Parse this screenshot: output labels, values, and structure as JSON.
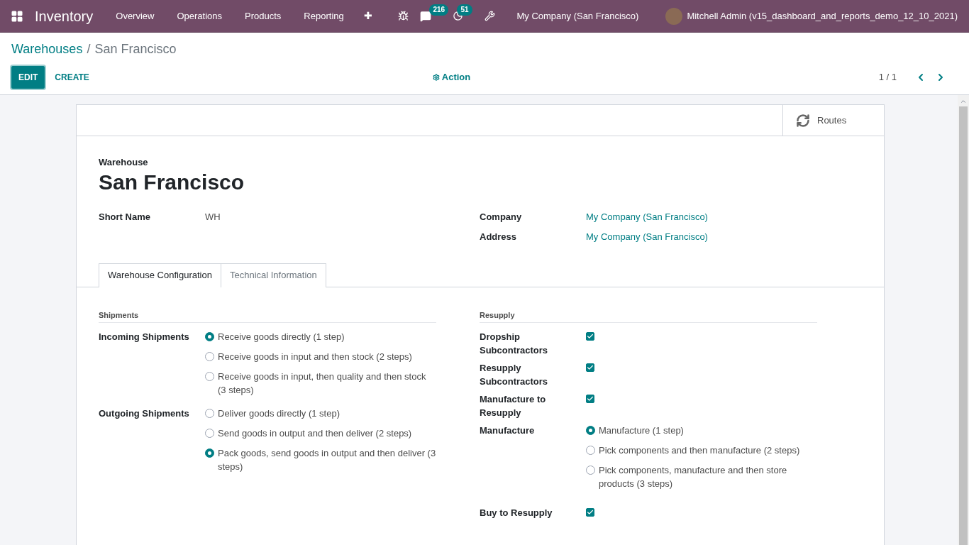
{
  "navbar": {
    "app_name": "Inventory",
    "menu": [
      "Overview",
      "Operations",
      "Products",
      "Reporting"
    ],
    "plus": "✚",
    "messages_count": "216",
    "activities_count": "51",
    "company": "My Company (San Francisco)",
    "user": "Mitchell Admin (v15_dashboard_and_reports_demo_12_10_2021)"
  },
  "breadcrumb": {
    "parent": "Warehouses",
    "separator": "/",
    "current": "San Francisco"
  },
  "control_panel": {
    "edit": "EDIT",
    "create": "CREATE",
    "action": "Action",
    "pager": "1 / 1"
  },
  "button_box": {
    "routes": "Routes"
  },
  "form": {
    "title_label": "Warehouse",
    "name": "San Francisco",
    "left_fields": [
      {
        "label": "Short Name",
        "value": "WH",
        "link": false
      }
    ],
    "right_fields": [
      {
        "label": "Company",
        "value": "My Company (San Francisco)",
        "link": true
      },
      {
        "label": "Address",
        "value": "My Company (San Francisco)",
        "link": true
      }
    ],
    "tabs": [
      {
        "label": "Warehouse Configuration",
        "selected": true
      },
      {
        "label": "Technical Information",
        "selected": false
      }
    ],
    "sections": [
      {
        "title": "Shipments",
        "rows": [
          {
            "label": "Incoming Shipments",
            "kind": "radio",
            "options": [
              {
                "label": "Receive goods directly (1 step)",
                "selected": true
              },
              {
                "label": "Receive goods in input and then stock (2 steps)",
                "selected": false
              },
              {
                "label": "Receive goods in input, then quality and then stock (3 steps)",
                "selected": false
              }
            ]
          },
          {
            "label": "Outgoing Shipments",
            "kind": "radio",
            "options": [
              {
                "label": "Deliver goods directly (1 step)",
                "selected": false
              },
              {
                "label": "Send goods in output and then deliver (2 steps)",
                "selected": false
              },
              {
                "label": "Pack goods, send goods in output and then deliver (3 steps)",
                "selected": true
              }
            ]
          }
        ]
      },
      {
        "title": "Resupply",
        "rows": [
          {
            "label": "Dropship Subcontractors",
            "kind": "checkbox",
            "checked": true
          },
          {
            "label": "Resupply Subcontractors",
            "kind": "checkbox",
            "checked": true
          },
          {
            "label": "Manufacture to Resupply",
            "kind": "checkbox",
            "checked": true
          },
          {
            "label": "Manufacture",
            "kind": "radio",
            "options": [
              {
                "label": "Manufacture (1 step)",
                "selected": true
              },
              {
                "label": "Pick components and then manufacture (2 steps)",
                "selected": false
              },
              {
                "label": "Pick components, manufacture and then store products (3 steps)",
                "selected": false
              }
            ]
          },
          {
            "label": "Buy to Resupply",
            "kind": "checkbox",
            "checked": true
          }
        ]
      }
    ]
  }
}
